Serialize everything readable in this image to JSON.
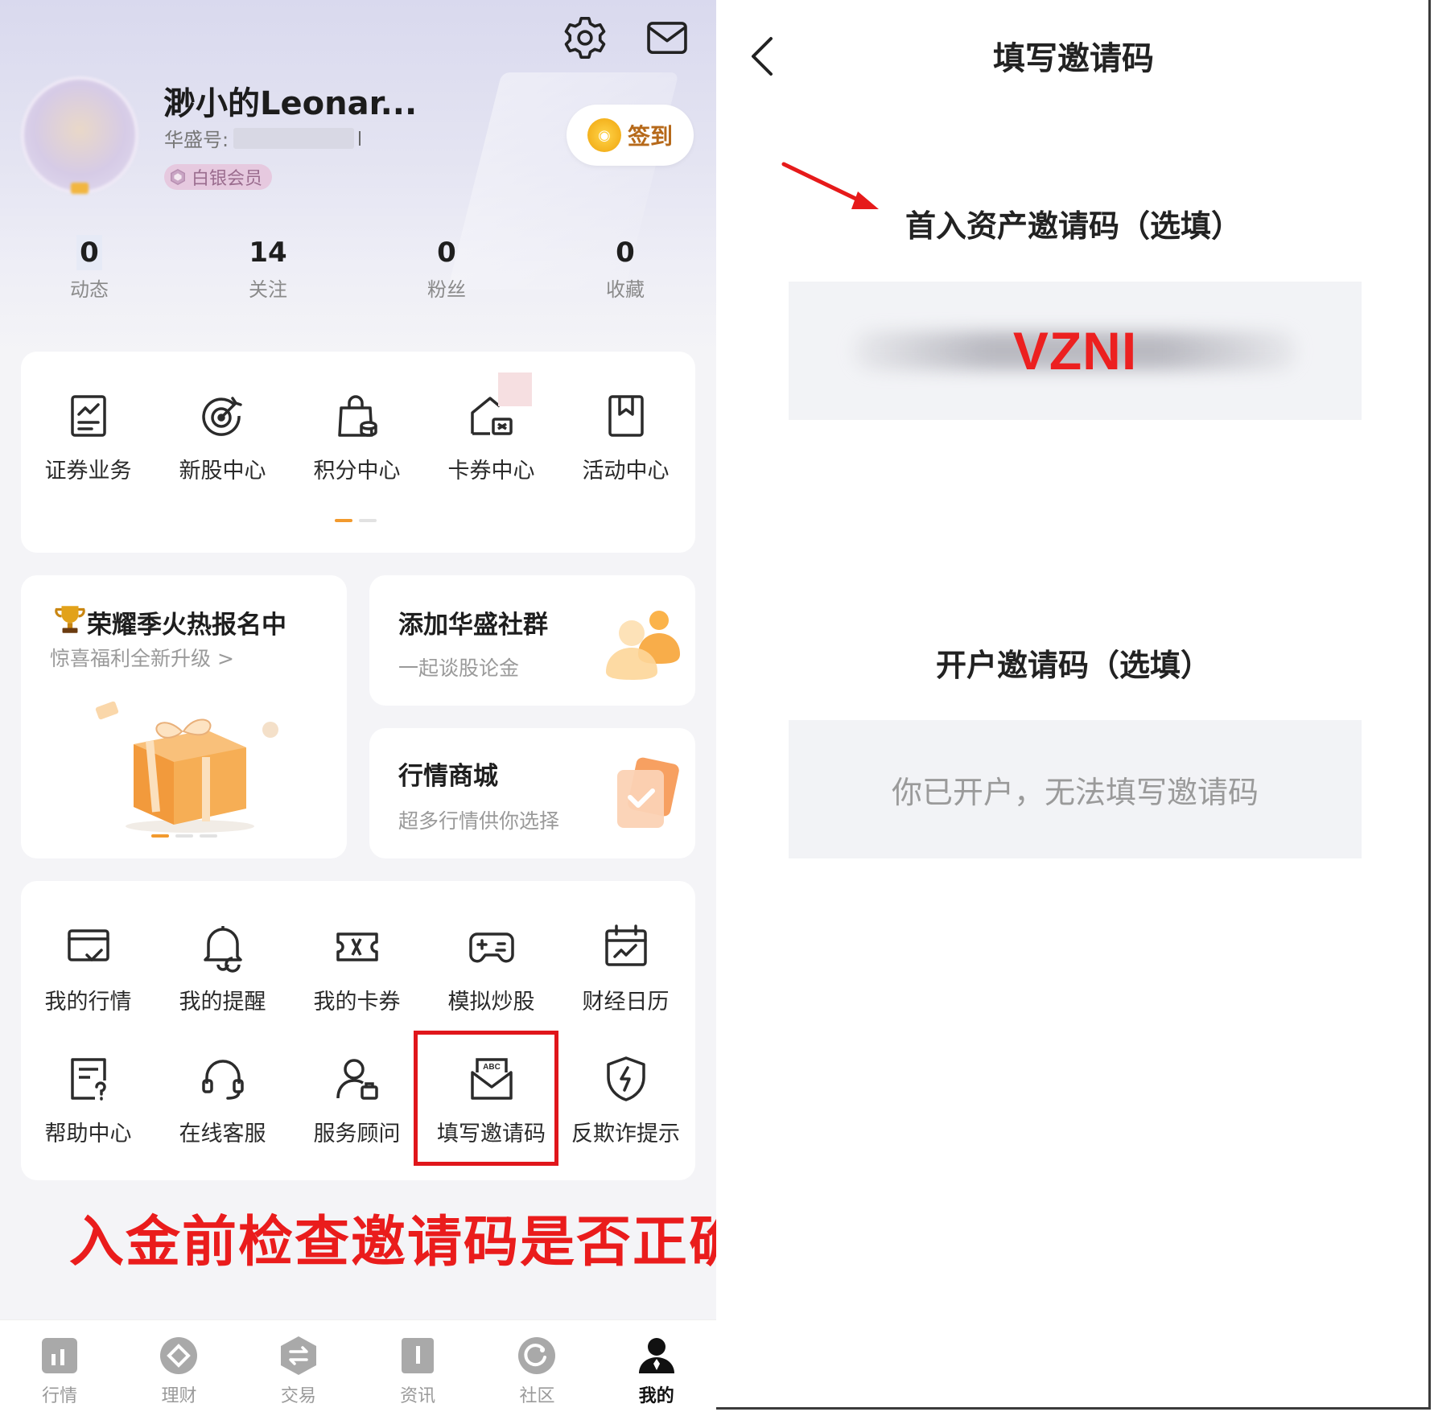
{
  "left": {
    "profile": {
      "username": "渺小的Leonar...",
      "account_label": "华盛号:",
      "vip_label": "白银会员",
      "signin_label": "签到"
    },
    "stats": [
      {
        "value": "0",
        "label": "动态"
      },
      {
        "value": "14",
        "label": "关注"
      },
      {
        "value": "0",
        "label": "粉丝"
      },
      {
        "value": "0",
        "label": "收藏"
      }
    ],
    "services": [
      {
        "label": "证券业务",
        "icon": "document-chart-icon"
      },
      {
        "label": "新股中心",
        "icon": "target-icon"
      },
      {
        "label": "积分中心",
        "icon": "shopping-bag-coins-icon"
      },
      {
        "label": "卡券中心",
        "icon": "coupon-house-icon"
      },
      {
        "label": "活动中心",
        "icon": "bookmark-icon"
      }
    ],
    "promo_main": {
      "title": "荣耀季火热报名中",
      "subtitle": "惊喜福利全新升级 >"
    },
    "promo_community": {
      "title": "添加华盛社群",
      "subtitle": "一起谈股论金"
    },
    "promo_mall": {
      "title": "行情商城",
      "subtitle": "超多行情供你选择"
    },
    "tools_row1": [
      {
        "label": "我的行情",
        "icon": "quote-card-icon"
      },
      {
        "label": "我的提醒",
        "icon": "bell-icon"
      },
      {
        "label": "我的卡券",
        "icon": "ticket-icon"
      },
      {
        "label": "模拟炒股",
        "icon": "gamepad-icon"
      },
      {
        "label": "财经日历",
        "icon": "calendar-chart-icon"
      }
    ],
    "tools_row2": [
      {
        "label": "帮助中心",
        "icon": "help-doc-icon"
      },
      {
        "label": "在线客服",
        "icon": "headset-icon"
      },
      {
        "label": "服务顾问",
        "icon": "advisor-icon"
      },
      {
        "label": "填写邀请码",
        "icon": "abc-envelope-icon"
      },
      {
        "label": "反欺诈提示",
        "icon": "shield-bolt-icon"
      }
    ],
    "warning_text": "入金前检查邀请码是否正确",
    "tabbar": [
      {
        "label": "行情",
        "icon": "market-icon"
      },
      {
        "label": "理财",
        "icon": "wealth-icon"
      },
      {
        "label": "交易",
        "icon": "trade-icon"
      },
      {
        "label": "资讯",
        "icon": "news-icon"
      },
      {
        "label": "社区",
        "icon": "community-icon"
      },
      {
        "label": "我的",
        "icon": "profile-icon",
        "active": true
      }
    ]
  },
  "right": {
    "title": "填写邀请码",
    "deposit_label": "首入资产邀请码（选填）",
    "deposit_code": "VZNI",
    "account_label": "开户邀请码（选填）",
    "account_disabled_text": "你已开户，无法填写邀请码"
  },
  "colors": {
    "accent_orange": "#f29a2e",
    "alert_red": "#e0161b",
    "input_bg": "#f2f3f6"
  }
}
